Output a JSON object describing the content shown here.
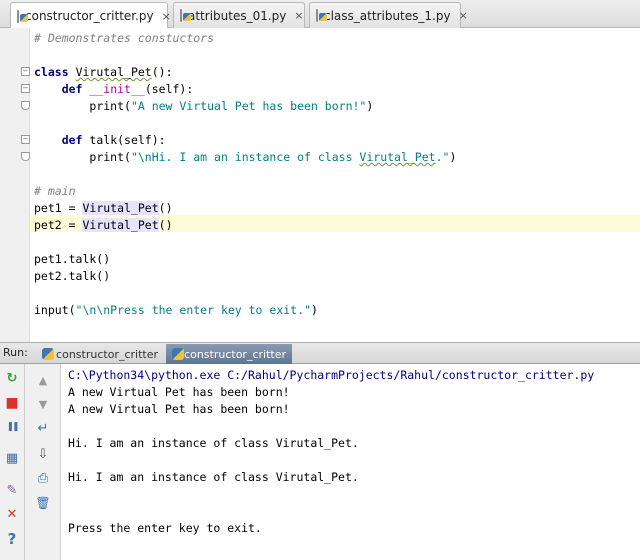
{
  "tabs": [
    {
      "label": "constructor_critter.py",
      "close": "×"
    },
    {
      "label": "attributes_01.py",
      "close": "×"
    },
    {
      "label": "class_attributes_1.py",
      "close": "×"
    }
  ],
  "code": {
    "l1": "# Demonstrates constuctors",
    "l2_kw": "class",
    "l2_name": "Virutal_Pet",
    "l2_rest": "():",
    "l3_kw": "def",
    "l3_name": "__init__",
    "l3_rest": "(self):",
    "l4_fn": "print(",
    "l4_str": "\"A new Virtual Pet has been born!\"",
    "l4_end": ")",
    "l5_kw": "def",
    "l5_rest": "talk(self):",
    "l6_fn": "print(",
    "l6_str_a": "\"\\nHi. I am an instance of class ",
    "l6_str_cls": "Virutal_Pet",
    "l6_str_b": ".\"",
    "l6_end": ")",
    "l7": "# main",
    "l8_a": "pet1 = ",
    "l8_cls": "Virutal_Pet",
    "l8_b": "()",
    "l9_a": "pet2 = ",
    "l9_cls": "Virutal_Pet",
    "l9_b": "()",
    "l10": "pet1.talk()",
    "l11": "pet2.talk()",
    "l12_fn": "input(",
    "l12_str": "\"\\n\\nPress the enter key to exit.\"",
    "l12_end": ")"
  },
  "run": {
    "label": "Run:",
    "tabs": [
      {
        "label": "constructor_critter"
      },
      {
        "label": "constructor_critter"
      }
    ]
  },
  "console": {
    "cmd": "C:\\Python34\\python.exe C:/Rahul/PycharmProjects/Rahul/constructor_critter.py",
    "out1": "A new Virtual Pet has been born!",
    "out2": "A new Virtual Pet has been born!",
    "out3": "Hi. I am an instance of class Virutal_Pet.",
    "out4": "Hi. I am an instance of class Virutal_Pet.",
    "out5": "Press the enter key to exit."
  },
  "icons": {
    "rerun": "↻",
    "stop": "■",
    "pause": "❚❚",
    "dump": "▦",
    "pin": "✎",
    "close": "✕",
    "help": "?",
    "up": "▲",
    "down": "▼",
    "softwrap": "↵",
    "scroll": "⇩",
    "print": "⎙",
    "trash": "🗑"
  },
  "colors": {
    "accent_blue": "#5f7493",
    "stop_red": "#d9342b",
    "rerun_green": "#3a9a3a",
    "highlight": "#fffbd9"
  }
}
